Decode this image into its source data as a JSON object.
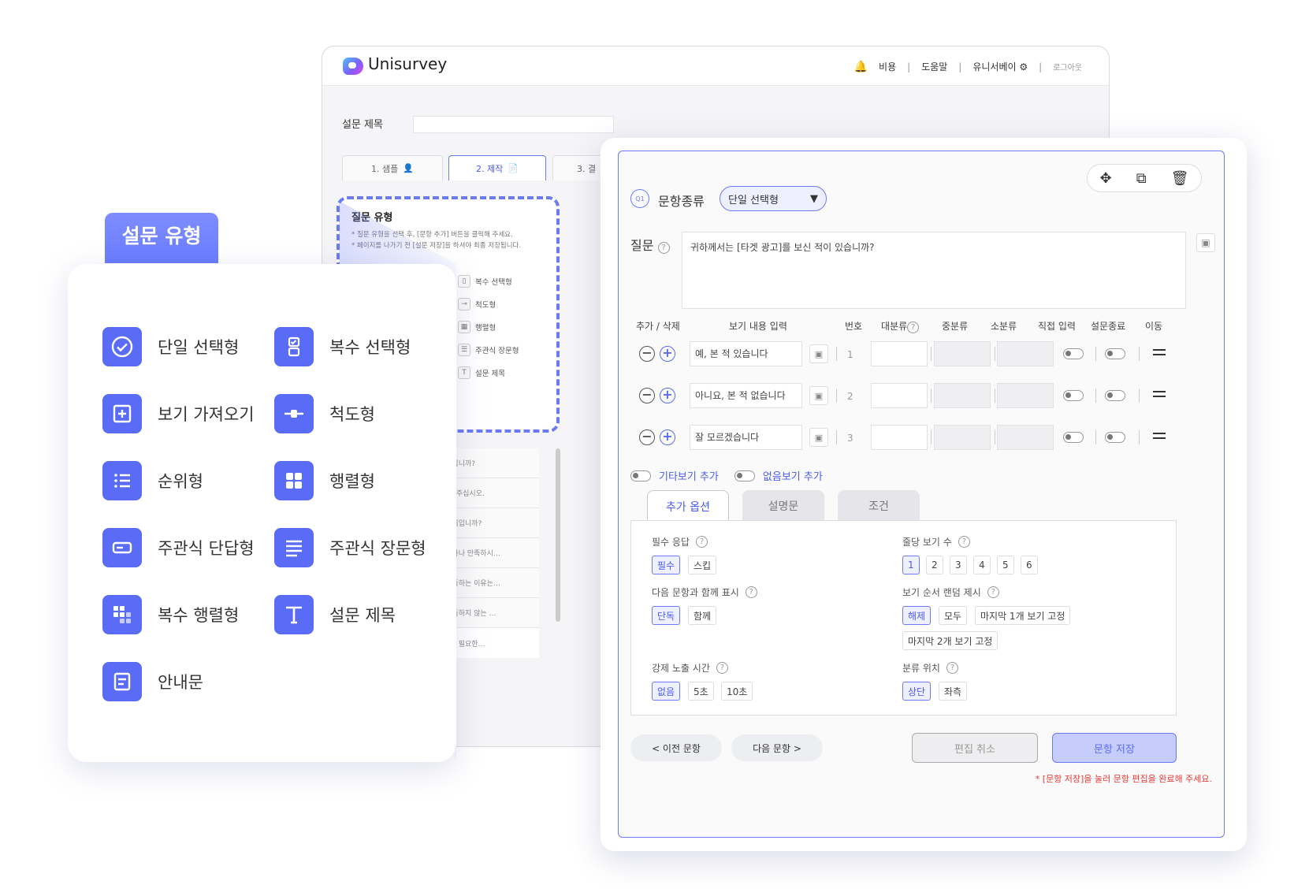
{
  "app": {
    "name": "Unisurvey",
    "nav": {
      "cost": "비용",
      "help": "도움말",
      "account": "유니서베이",
      "logout": "로그아웃"
    }
  },
  "survey_title_label": "설문 제목",
  "tabs": [
    {
      "label": "1. 샘플"
    },
    {
      "label": "2. 제작"
    },
    {
      "label": "3. 결"
    }
  ],
  "question_type_panel": {
    "title": "질문 유형",
    "desc1": "* 질문 유형을 선택 후, [문항 추가] 버튼을 클릭해 주세요.",
    "desc2": "* 페이지를 나가기 전 [설문 저장]을 하셔야 최종 저장됩니다.",
    "mini_items": [
      "복수 선택형",
      "척도형",
      "행렬형",
      "주관식 장문형",
      "설문 제목"
    ]
  },
  "bg_question_rows": [
    "게 되십니까?",
    "입력해주십시오.",
    "은 어디입니까?",
    "후 얼마나 만족하시…",
    "후 만족하는 이유는…",
    "후 만족하지 않는 …",
    "개선이 필요한…"
  ],
  "type_tag": "설문 유형",
  "question_types": [
    {
      "label": "단일 선택형",
      "icon": "check-circle-icon"
    },
    {
      "label": "복수 선택형",
      "icon": "multi-check-icon"
    },
    {
      "label": "보기 가져오기",
      "icon": "plus-square-icon"
    },
    {
      "label": "척도형",
      "icon": "slider-icon"
    },
    {
      "label": "순위형",
      "icon": "list-icon"
    },
    {
      "label": "행렬형",
      "icon": "grid-icon"
    },
    {
      "label": "주관식 단답형",
      "icon": "short-text-icon"
    },
    {
      "label": "주관식 장문형",
      "icon": "long-text-icon"
    },
    {
      "label": "복수 행렬형",
      "icon": "multi-grid-icon"
    },
    {
      "label": "설문 제목",
      "icon": "text-t-icon"
    },
    {
      "label": "안내문",
      "icon": "notice-icon"
    }
  ],
  "editor": {
    "qbadge": "Q1",
    "qtype_label": "문항종류",
    "qtype_value": "단일 선택형",
    "question_label": "질문",
    "question_text": "귀하께서는 [타겟 광고]를 보신 적이 있습니까?",
    "columns": [
      "추가 / 삭제",
      "보기 내용 입력",
      "번호",
      "대분류",
      "중분류",
      "소분류",
      "직접 입력",
      "설문종료",
      "이동"
    ],
    "options": [
      {
        "text": "예, 본 적 있습니다",
        "num": "1"
      },
      {
        "text": "아니요, 본 적 없습니다",
        "num": "2"
      },
      {
        "text": "잘 모르겠습니다",
        "num": "3"
      }
    ],
    "other_label": "기타보기 추가",
    "none_label": "없음보기 추가",
    "subtabs": [
      "추가 옵션",
      "설명문",
      "조건"
    ],
    "settings": {
      "required": {
        "label": "필수 응답",
        "choices": [
          "필수",
          "스킵"
        ]
      },
      "per_row": {
        "label": "줄당 보기 수",
        "choices": [
          "1",
          "2",
          "3",
          "4",
          "5",
          "6"
        ]
      },
      "show_with_next": {
        "label": "다음 문항과 함께 표시",
        "choices": [
          "단독",
          "함께"
        ]
      },
      "random": {
        "label": "보기 순서 랜덤 제시",
        "choices": [
          "해제",
          "모두",
          "마지막 1개 보기 고정",
          "마지막 2개 보기 고정"
        ]
      },
      "forced_time": {
        "label": "강제 노출 시간",
        "choices": [
          "없음",
          "5초",
          "10초"
        ]
      },
      "class_pos": {
        "label": "분류 위치",
        "choices": [
          "상단",
          "좌측"
        ]
      }
    },
    "prev": "< 이전 문항",
    "next": "다음 문항 >",
    "cancel": "편집 취소",
    "save": "문항 저장",
    "warning": "* [문항 저장]을 눌러 문항 편집을 완료해 주세요."
  },
  "colors": {
    "accent": "#5a6cf5",
    "warning": "#e53935"
  }
}
